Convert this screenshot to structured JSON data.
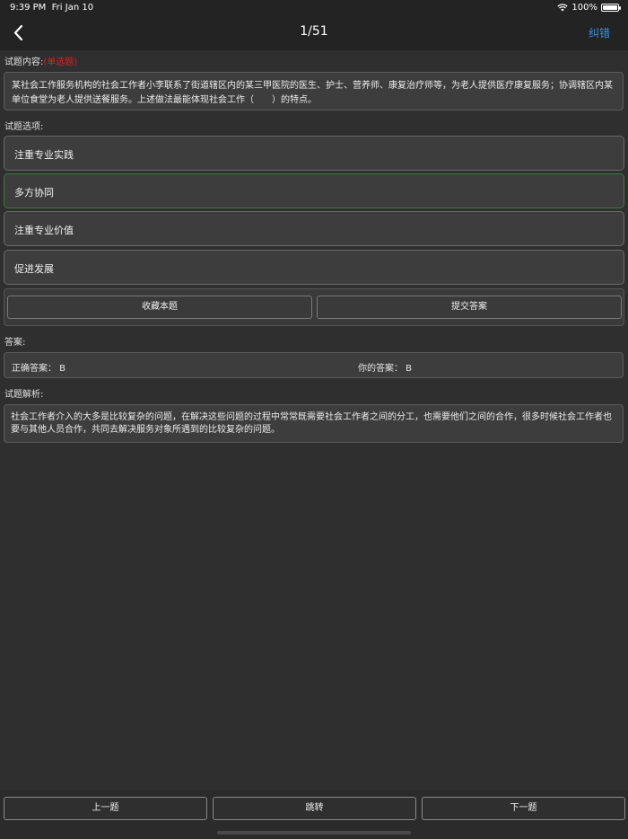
{
  "status_bar": {
    "time": "9:39 PM",
    "date": "Fri Jan 10",
    "battery": "100%",
    "battery_level": 1.0
  },
  "nav": {
    "title": "1/51",
    "action": "纠错",
    "back_icon": "chevron-left-icon"
  },
  "question": {
    "label": "试题内容:",
    "type": "(单选题)",
    "text": "某社会工作服务机构的社会工作者小李联系了街道辖区内的某三甲医院的医生、护士、营养师、康复治疗师等，为老人提供医疗康复服务；协调辖区内某单位食堂为老人提供送餐服务。上述做法最能体现社会工作（　　）的特点。"
  },
  "options_label": "试题选项:",
  "options": [
    {
      "text": "注重专业实践"
    },
    {
      "text": "多方协同"
    },
    {
      "text": "注重专业价值"
    },
    {
      "text": "促进发展"
    }
  ],
  "actions": {
    "favorite": "收藏本题",
    "submit": "提交答案"
  },
  "answer": {
    "label": "答案:",
    "correct": "正确答案：  B",
    "yours": "你的答案：  B"
  },
  "analysis": {
    "label": "试题解析:",
    "text": "社会工作者介入的大多是比较复杂的问题，在解决这些问题的过程中常常既需要社会工作者之间的分工，也需要他们之间的合作，很多时候社会工作者也要与其他人员合作，共同去解决服务对象所遇到的比较复杂的问题。"
  },
  "bottom": {
    "prev": "上一题",
    "jump": "跳转",
    "next": "下一题"
  },
  "colors": {
    "accent": "#3b8fe8",
    "type_red": "#e02020",
    "correct_border": "#3f7a3f"
  }
}
